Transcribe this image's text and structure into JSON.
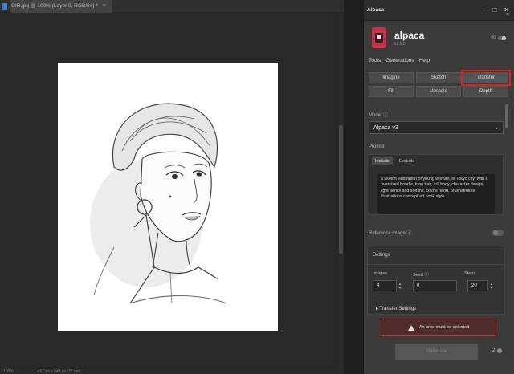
{
  "document": {
    "tab_title": "OIR.jpg @ 100% (Layer 0, RGB/8#) *",
    "status_left": "100%",
    "status_mid": "467 px x 649 px (72 ppi)"
  },
  "panel": {
    "tab_label": "Alpaca",
    "window_controls": [
      "–",
      "□",
      "✕"
    ],
    "app_name": "alpaca",
    "version": "v2.5.0",
    "toggle_label": "00",
    "menu": [
      "Tools",
      "Generations",
      "Help"
    ],
    "tools": [
      {
        "label": "Imagine",
        "active": false
      },
      {
        "label": "Sketch",
        "active": false
      },
      {
        "label": "Transfer",
        "active": true
      },
      {
        "label": "Fill",
        "active": false
      },
      {
        "label": "Upscale",
        "active": false
      },
      {
        "label": "Depth",
        "active": false
      }
    ],
    "model_label": "Model ⓘ",
    "model_value": "Alpaca v3",
    "prompt_label": "Prompt",
    "prompt_tabs": [
      "Include",
      "Exclude"
    ],
    "prompt_text": "a sketch illustration of young woman, in Tokyo city, with a oversized hoodie, long hair, full body, character design, light pencil and soft ink, colors neon, brushstrokes, illustrations concept art book style",
    "reference_label": "Reference image ⓘ",
    "settings_label": "Settings",
    "fields": {
      "images_label": "Images",
      "images_value": "4",
      "seed_label": "Seed ⓘ",
      "seed_value": "0",
      "steps_label": "Steps",
      "steps_value": "20"
    },
    "transfer_settings": "Transfer Settings",
    "error_message": "An area must be selected",
    "generate_label": "Generate",
    "count": "2"
  },
  "accent": {
    "highlight": "#e02020",
    "error_border": "#c0392b",
    "logo": "#c7344a"
  }
}
